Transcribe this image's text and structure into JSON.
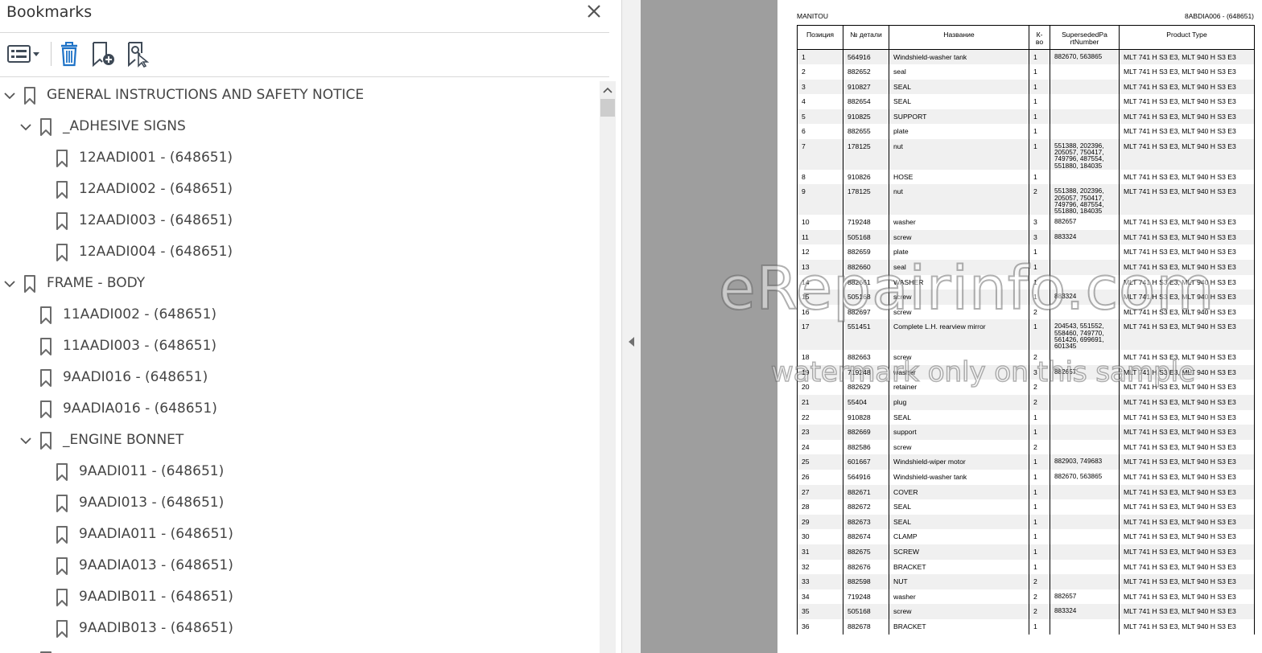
{
  "bookmarks_panel": {
    "title": "Bookmarks",
    "toolbar": {
      "options_icon": "options-list-icon",
      "delete_icon": "trash-icon",
      "new_bookmark_icon": "add-bookmark-icon",
      "find_bookmark_icon": "find-current-bookmark-icon"
    },
    "items": [
      {
        "label": "GENERAL INSTRUCTIONS AND SAFETY NOTICE",
        "level": 0,
        "expandable": true
      },
      {
        "label": "_ADHESIVE SIGNS",
        "level": 1,
        "expandable": true
      },
      {
        "label": "12AADI001 - (648651)",
        "level": 2,
        "expandable": false
      },
      {
        "label": "12AADI002 - (648651)",
        "level": 2,
        "expandable": false
      },
      {
        "label": "12AADI003 - (648651)",
        "level": 2,
        "expandable": false
      },
      {
        "label": "12AADI004 - (648651)",
        "level": 2,
        "expandable": false
      },
      {
        "label": "FRAME - BODY",
        "level": 0,
        "expandable": true
      },
      {
        "label": "11AADI002 - (648651)",
        "level": 1,
        "expandable": false
      },
      {
        "label": "11AADI003 - (648651)",
        "level": 1,
        "expandable": false
      },
      {
        "label": "9AADI016 - (648651)",
        "level": 1,
        "expandable": false
      },
      {
        "label": "9AADIA016 - (648651)",
        "level": 1,
        "expandable": false
      },
      {
        "label": "_ENGINE BONNET",
        "level": 1,
        "expandable": true
      },
      {
        "label": "9AADI011 - (648651)",
        "level": 2,
        "expandable": false
      },
      {
        "label": "9AADI013 - (648651)",
        "level": 2,
        "expandable": false
      },
      {
        "label": "9AADIA011 - (648651)",
        "level": 2,
        "expandable": false
      },
      {
        "label": "9AADIA013 - (648651)",
        "level": 2,
        "expandable": false
      },
      {
        "label": "9AADIB011 - (648651)",
        "level": 2,
        "expandable": false
      },
      {
        "label": "9AADIB013 - (648651)",
        "level": 2,
        "expandable": false
      },
      {
        "label": "",
        "level": 1,
        "expandable": false
      }
    ]
  },
  "document": {
    "brand": "MANITOU",
    "code": "8ABDIA006 - (648651)",
    "columns": [
      "Позиция",
      "№ детали",
      "Название",
      "К-во",
      "SupersededPa rtNumber",
      "Product Type"
    ],
    "rows": [
      [
        "1",
        "564916",
        "Windshield-washer tank",
        "1",
        "882670, 563865",
        "MLT 741 H S3 E3, MLT 940 H S3 E3"
      ],
      [
        "2",
        "882652",
        "seal",
        "1",
        "",
        "MLT 741 H S3 E3, MLT 940 H S3 E3"
      ],
      [
        "3",
        "910827",
        "SEAL",
        "1",
        "",
        "MLT 741 H S3 E3, MLT 940 H S3 E3"
      ],
      [
        "4",
        "882654",
        "SEAL",
        "1",
        "",
        "MLT 741 H S3 E3, MLT 940 H S3 E3"
      ],
      [
        "5",
        "910825",
        "SUPPORT",
        "1",
        "",
        "MLT 741 H S3 E3, MLT 940 H S3 E3"
      ],
      [
        "6",
        "882655",
        "plate",
        "1",
        "",
        "MLT 741 H S3 E3, MLT 940 H S3 E3"
      ],
      [
        "7",
        "178125",
        "nut",
        "1",
        "551388, 202396, 205057, 750417, 749796, 487554, 551880, 184035",
        "MLT 741 H S3 E3, MLT 940 H S3 E3"
      ],
      [
        "8",
        "910826",
        "HOSE",
        "1",
        "",
        "MLT 741 H S3 E3, MLT 940 H S3 E3"
      ],
      [
        "9",
        "178125",
        "nut",
        "2",
        "551388, 202396, 205057, 750417, 749796, 487554, 551880, 184035",
        "MLT 741 H S3 E3, MLT 940 H S3 E3"
      ],
      [
        "10",
        "719248",
        "washer",
        "3",
        "882657",
        "MLT 741 H S3 E3, MLT 940 H S3 E3"
      ],
      [
        "11",
        "505168",
        "screw",
        "3",
        "883324",
        "MLT 741 H S3 E3, MLT 940 H S3 E3"
      ],
      [
        "12",
        "882659",
        "plate",
        "1",
        "",
        "MLT 741 H S3 E3, MLT 940 H S3 E3"
      ],
      [
        "13",
        "882660",
        "seal",
        "1",
        "",
        "MLT 741 H S3 E3, MLT 940 H S3 E3"
      ],
      [
        "14",
        "882661",
        "WASHER",
        "1",
        "",
        "MLT 741 H S3 E3, MLT 940 H S3 E3"
      ],
      [
        "15",
        "505168",
        "screw",
        "1",
        "883324",
        "MLT 741 H S3 E3, MLT 940 H S3 E3"
      ],
      [
        "16",
        "882697",
        "screw",
        "2",
        "",
        "MLT 741 H S3 E3, MLT 940 H S3 E3"
      ],
      [
        "17",
        "551451",
        "Complete L.H. rearview mirror",
        "1",
        "204543, 551552, 558460, 749770, 561426, 699691, 601345",
        "MLT 741 H S3 E3, MLT 940 H S3 E3"
      ],
      [
        "18",
        "882663",
        "screw",
        "2",
        "",
        "MLT 741 H S3 E3, MLT 940 H S3 E3"
      ],
      [
        "19",
        "719248",
        "washer",
        "3",
        "882657",
        "MLT 741 H S3 E3, MLT 940 H S3 E3"
      ],
      [
        "20",
        "882629",
        "retainer",
        "2",
        "",
        "MLT 741 H S3 E3, MLT 940 H S3 E3"
      ],
      [
        "21",
        "55404",
        "plug",
        "2",
        "",
        "MLT 741 H S3 E3, MLT 940 H S3 E3"
      ],
      [
        "22",
        "910828",
        "SEAL",
        "1",
        "",
        "MLT 741 H S3 E3, MLT 940 H S3 E3"
      ],
      [
        "23",
        "882669",
        "support",
        "1",
        "",
        "MLT 741 H S3 E3, MLT 940 H S3 E3"
      ],
      [
        "24",
        "882586",
        "screw",
        "2",
        "",
        "MLT 741 H S3 E3, MLT 940 H S3 E3"
      ],
      [
        "25",
        "601667",
        "Windshield-wiper motor",
        "1",
        "882903, 749683",
        "MLT 741 H S3 E3, MLT 940 H S3 E3"
      ],
      [
        "26",
        "564916",
        "Windshield-washer tank",
        "1",
        "882670, 563865",
        "MLT 741 H S3 E3, MLT 940 H S3 E3"
      ],
      [
        "27",
        "882671",
        "COVER",
        "1",
        "",
        "MLT 741 H S3 E3, MLT 940 H S3 E3"
      ],
      [
        "28",
        "882672",
        "SEAL",
        "1",
        "",
        "MLT 741 H S3 E3, MLT 940 H S3 E3"
      ],
      [
        "29",
        "882673",
        "SEAL",
        "1",
        "",
        "MLT 741 H S3 E3, MLT 940 H S3 E3"
      ],
      [
        "30",
        "882674",
        "CLAMP",
        "1",
        "",
        "MLT 741 H S3 E3, MLT 940 H S3 E3"
      ],
      [
        "31",
        "882675",
        "SCREW",
        "1",
        "",
        "MLT 741 H S3 E3, MLT 940 H S3 E3"
      ],
      [
        "32",
        "882676",
        "BRACKET",
        "1",
        "",
        "MLT 741 H S3 E3, MLT 940 H S3 E3"
      ],
      [
        "33",
        "882598",
        "NUT",
        "2",
        "",
        "MLT 741 H S3 E3, MLT 940 H S3 E3"
      ],
      [
        "34",
        "719248",
        "washer",
        "2",
        "882657",
        "MLT 741 H S3 E3, MLT 940 H S3 E3"
      ],
      [
        "35",
        "505168",
        "screw",
        "2",
        "883324",
        "MLT 741 H S3 E3, MLT 940 H S3 E3"
      ],
      [
        "36",
        "882678",
        "BRACKET",
        "1",
        "",
        "MLT 741 H S3 E3, MLT 940 H S3 E3"
      ]
    ]
  },
  "watermark": {
    "line1": "eRepairinfo.com",
    "line2": "watermark only on this sample"
  }
}
